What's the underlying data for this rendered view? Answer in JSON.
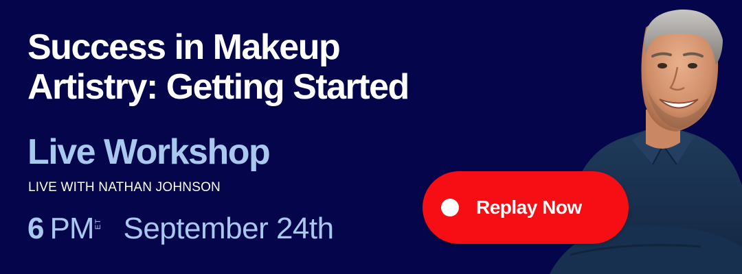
{
  "banner": {
    "title_line1": "Success in Makeup",
    "title_line2": "Artistry: Getting Started",
    "subtitle": "Live Workshop",
    "host_line": "LIVE WITH NATHAN JOHNSON",
    "time_hour": "6",
    "time_ampm": "PM",
    "time_zone": "ET",
    "date": "September 24th",
    "cta_label": "Replay Now"
  },
  "colors": {
    "background": "#05054b",
    "title": "#ffffff",
    "accent_light_blue": "#a9c8ee",
    "cta_red": "#f70d14"
  },
  "icons": {
    "cta_icon": "record-dot-icon"
  }
}
